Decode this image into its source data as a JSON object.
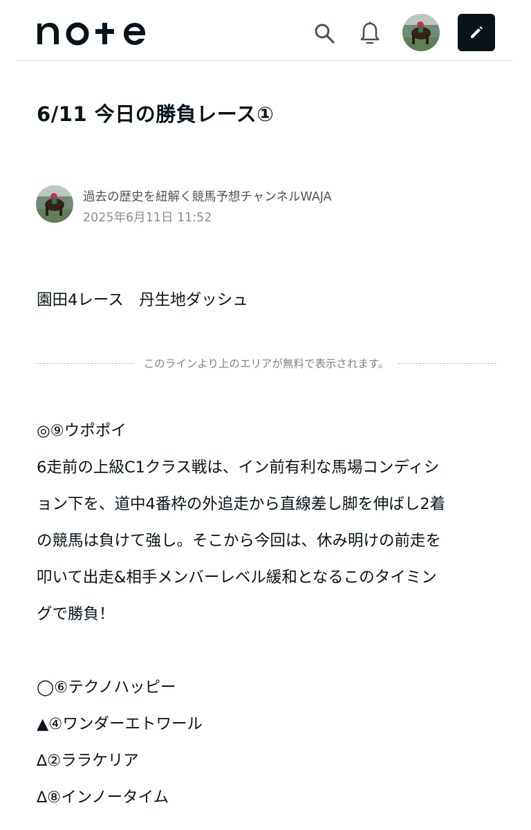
{
  "header": {
    "logo_text": "note",
    "search_icon": "search-icon",
    "bell_icon": "bell-icon",
    "avatar_icon": "user-avatar-horse",
    "compose_icon": "pencil-icon",
    "colors": {
      "compose_bg": "#08131a",
      "divider": "#dcdfe2"
    }
  },
  "article": {
    "title": "6/11 今日の勝負レース①",
    "author": {
      "name": "過去の歴史を紐解く競馬予想チャンネルWAJA",
      "date": "2025年6月11日 11:52"
    },
    "lead": "園田4レース　丹生地ダッシュ",
    "paywall_notice": "このラインより上のエリアが無料で表示されます。",
    "pick_main": "◎⑨ウポポイ",
    "comment_lines": [
      "6走前の上級C1クラス戦は、イン前有利な馬場コンディシ",
      "ョン下を、道中4番枠の外追走から直線差し脚を伸ばし2着",
      "の競馬は負けて強し。そこから今回は、休み明けの前走を",
      "叩いて出走&相手メンバーレベル緩和となるこのタイミン",
      "グで勝負！"
    ],
    "sub_picks": [
      "◯⑥テクノハッピー",
      "▲④ワンダーエトワール",
      "∆②ララケリア",
      "∆⑧インノータイム"
    ]
  }
}
